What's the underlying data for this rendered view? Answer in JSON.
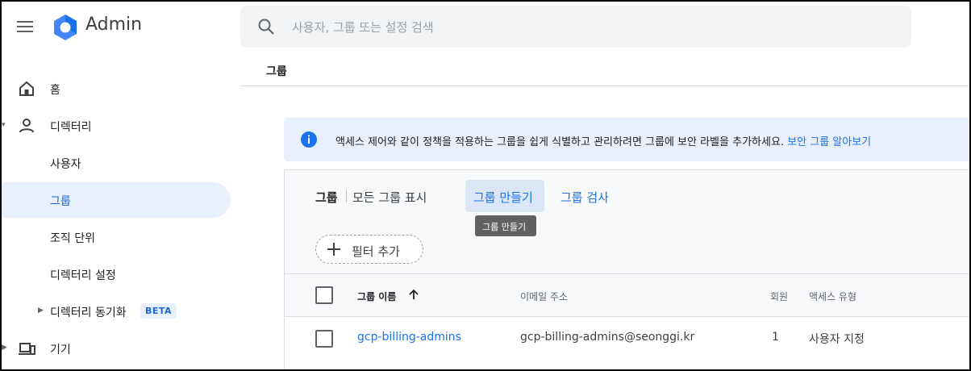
{
  "app": {
    "title": "Admin"
  },
  "search": {
    "placeholder": "사용자, 그룹 또는 설정 검색"
  },
  "breadcrumb": "그룹",
  "sidebar": {
    "items": [
      {
        "label": "홈"
      },
      {
        "label": "디렉터리"
      },
      {
        "label": "사용자"
      },
      {
        "label": "그룹"
      },
      {
        "label": "조직 단위"
      },
      {
        "label": "디렉터리 설정"
      },
      {
        "label": "디렉터리 동기화",
        "badge": "BETA"
      },
      {
        "label": "기기"
      }
    ]
  },
  "banner": {
    "text": "액세스 제어와 같이 정책을 적용하는 그룹을 쉽게 식별하고 관리하려면 그룹에 보안 라벨을 추가하세요.",
    "link": "보안 그룹 알아보기"
  },
  "toolbar": {
    "title": "그룹",
    "show_all": "모든 그룹 표시",
    "create": "그룹 만들기",
    "search": "그룹 검사",
    "tooltip": "그룹 만들기",
    "filter": "필터 추가"
  },
  "table": {
    "columns": [
      "그룹 이름",
      "이메일 주소",
      "회원",
      "액세스 유형"
    ],
    "rows": [
      {
        "name": "gcp-billing-admins",
        "email": "gcp-billing-admins@seonggi.kr",
        "members": "1",
        "access": "사용자 지정"
      }
    ]
  },
  "colors": {
    "accent": "#1a73e8",
    "active_bg": "#e8f0fe",
    "logo": "#4285f4"
  }
}
